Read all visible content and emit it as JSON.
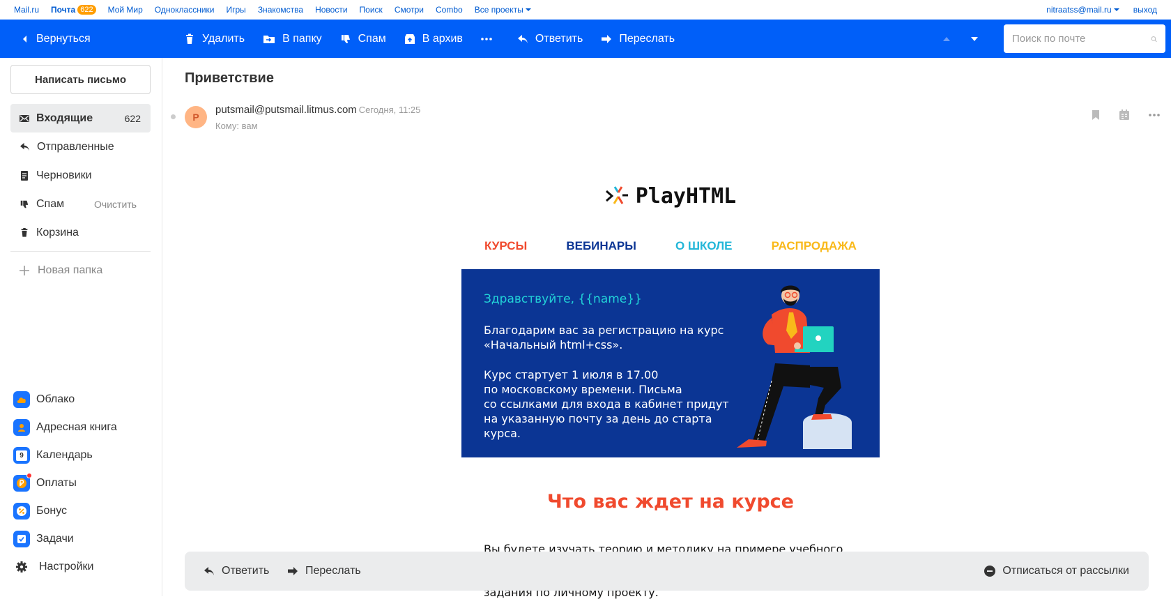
{
  "portal": {
    "links": [
      "Mail.ru",
      "Почта",
      "Мой Мир",
      "Одноклассники",
      "Игры",
      "Знакомства",
      "Новости",
      "Поиск",
      "Смотри",
      "Combo",
      "Все проекты"
    ],
    "mail_badge": "622",
    "user": "nitraatss@mail.ru",
    "logout": "выход"
  },
  "toolbar": {
    "back": "Вернуться",
    "delete": "Удалить",
    "to_folder": "В папку",
    "spam": "Спам",
    "archive": "В архив",
    "reply": "Ответить",
    "forward": "Переслать",
    "search_placeholder": "Поиск по почте"
  },
  "sidebar": {
    "compose": "Написать письмо",
    "folders": [
      {
        "label": "Входящие",
        "count": "622",
        "icon": "inbox-icon"
      },
      {
        "label": "Отправленные",
        "icon": "sent-icon"
      },
      {
        "label": "Черновики",
        "icon": "drafts-icon"
      },
      {
        "label": "Спам",
        "action": "Очистить",
        "icon": "spam-icon"
      },
      {
        "label": "Корзина",
        "icon": "trash-icon"
      }
    ],
    "new_folder": "Новая папка",
    "apps": [
      {
        "label": "Облако",
        "icon": "cloud-icon",
        "color": "#1a74ff"
      },
      {
        "label": "Адресная книга",
        "icon": "contacts-icon",
        "color": "#1a74ff"
      },
      {
        "label": "Календарь",
        "icon": "calendar-icon",
        "color": "#1a74ff"
      },
      {
        "label": "Оплаты",
        "icon": "payments-icon",
        "color": "#1a74ff"
      },
      {
        "label": "Бонус",
        "icon": "bonus-icon",
        "color": "#1a74ff"
      },
      {
        "label": "Задачи",
        "icon": "tasks-icon",
        "color": "#1a74ff"
      },
      {
        "label": "Настройки",
        "icon": "settings-icon",
        "color": "#333333"
      }
    ],
    "calendar_day": "9"
  },
  "message": {
    "subject": "Приветствие",
    "avatar_letter": "P",
    "from": "putsmail@putsmail.litmus.com",
    "date": "Сегодня, 11:25",
    "to": "Кому: вам"
  },
  "email": {
    "logo": "PlayHTML",
    "nav": [
      {
        "label": "КУРСЫ",
        "color": "#f04a2e"
      },
      {
        "label": "ВЕБИНАРЫ",
        "color": "#0b3594"
      },
      {
        "label": "О ШКОЛЕ",
        "color": "#22b6d8"
      },
      {
        "label": "РАСПРОДАЖА",
        "color": "#f9b91a"
      }
    ],
    "greeting": "Здравствуйте, {{name}}",
    "paragraph1": "Благодарим вас за регистрацию на курс\n«Начальный html+css».",
    "paragraph2": "Курс стартует 1 июля в 17.00\nпо московскому времени. Письма\nсо ссылками для входа в кабинет придут\nна указанную почту за день до старта\nкурса.",
    "section_title": "Что вас ждет на курсе",
    "body_line1": "Вы будете изучать теорию и методику на примере учебного",
    "body_line2": "задания по личному проекту."
  },
  "bottombar": {
    "reply": "Ответить",
    "forward": "Переслать",
    "unsubscribe": "Отписаться от рассылки"
  },
  "colors": {
    "toolbar_bg": "#005ff9",
    "banner_bg": "#0b3594",
    "link": "#005bd1",
    "badge": "#ff9e00"
  }
}
